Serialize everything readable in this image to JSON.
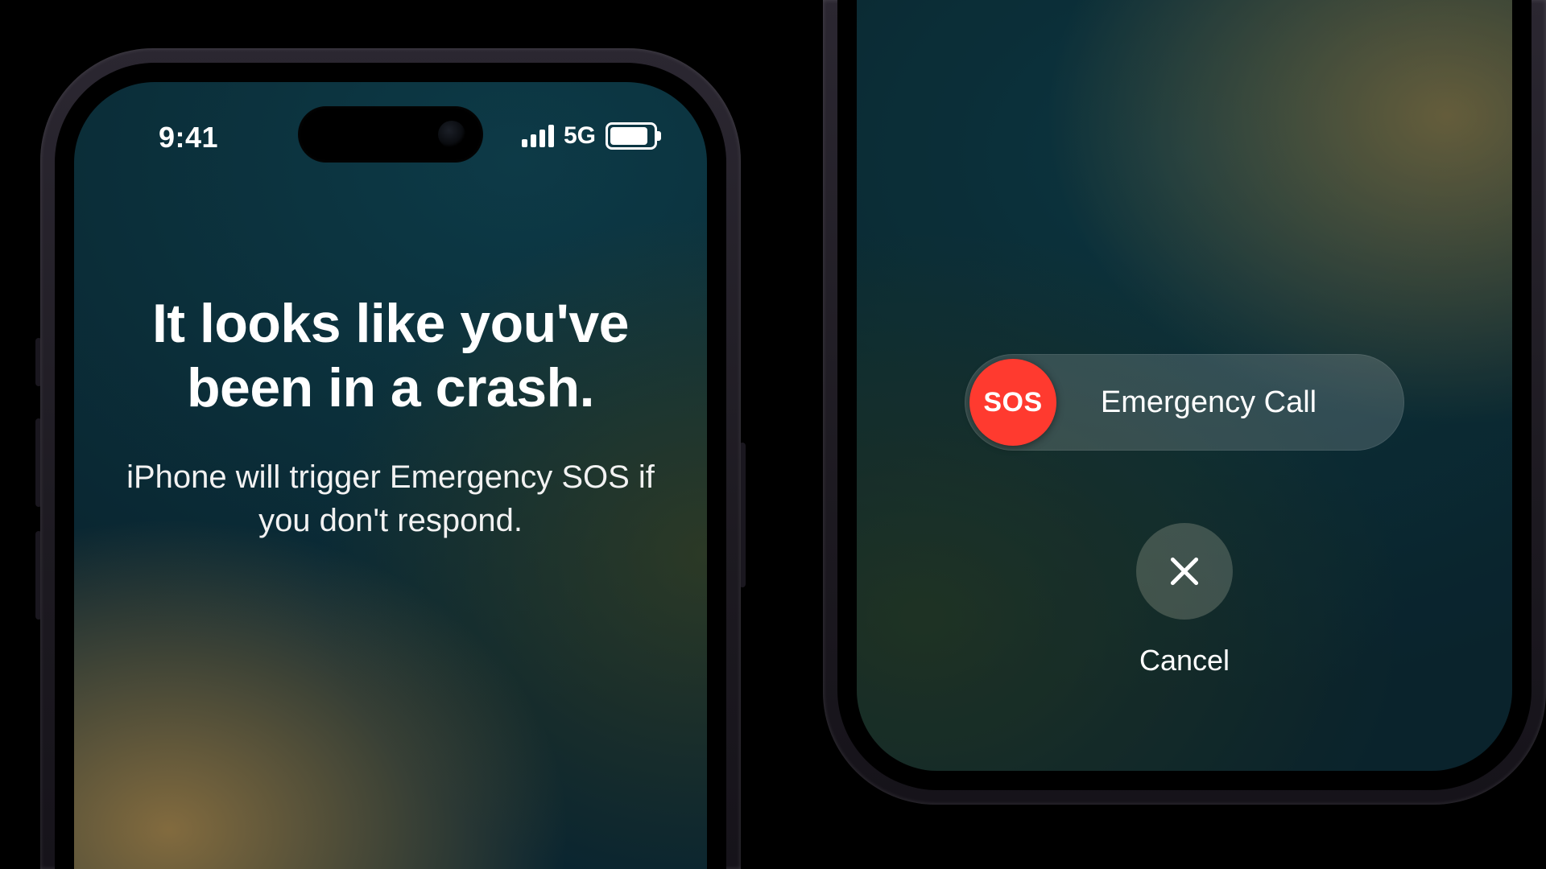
{
  "statusbar": {
    "time": "9:41",
    "network_label": "5G"
  },
  "left_phone": {
    "headline": "It looks like you've been in a crash.",
    "subline": "iPhone will trigger Emergency SOS if you don't respond."
  },
  "right_phone": {
    "sos_knob_label": "SOS",
    "sos_slider_label": "Emergency Call",
    "cancel_label": "Cancel"
  },
  "colors": {
    "sos_red": "#ff3a2f"
  }
}
